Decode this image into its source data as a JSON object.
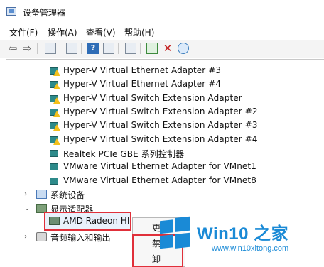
{
  "window": {
    "title": "设备管理器"
  },
  "menu": [
    {
      "label": "文件(F)"
    },
    {
      "label": "操作(A)"
    },
    {
      "label": "查看(V)"
    },
    {
      "label": "帮助(H)"
    }
  ],
  "toolbar_icons": [
    "back-arrow-icon",
    "forward-arrow-icon",
    "properties-icon",
    "update-icon",
    "help-icon",
    "view-icon",
    "scan-hardware-icon",
    "update-driver-icon",
    "disable-device-icon",
    "download-icon"
  ],
  "devices": [
    {
      "label": "Hyper-V Virtual Ethernet Adapter #3",
      "warning": true
    },
    {
      "label": "Hyper-V Virtual Ethernet Adapter #4",
      "warning": true
    },
    {
      "label": "Hyper-V Virtual Switch Extension Adapter",
      "warning": true
    },
    {
      "label": "Hyper-V Virtual Switch Extension Adapter #2",
      "warning": true
    },
    {
      "label": "Hyper-V Virtual Switch Extension Adapter #3",
      "warning": true
    },
    {
      "label": "Hyper-V Virtual Switch Extension Adapter #4",
      "warning": true
    },
    {
      "label": "Realtek PCIe GBE 系列控制器",
      "warning": false
    },
    {
      "label": "VMware Virtual Ethernet Adapter for VMnet1",
      "warning": false
    },
    {
      "label": "VMware Virtual Ethernet Adapter for VMnet8",
      "warning": false
    }
  ],
  "categories": {
    "system": "系统设备",
    "display": "显示适配器",
    "audio": "音频输入和输出"
  },
  "selected_device": "AMD Radeon HI",
  "context_menu": [
    "更",
    "禁",
    "卸"
  ],
  "watermark": {
    "title": "Win10 之家",
    "url": "www.win10xitong.com",
    "color": "#1a8ad6"
  },
  "colors": {
    "highlight_border": "#e0303a",
    "warning": "#f3c01b",
    "network_icon": "#2d8a8a"
  }
}
